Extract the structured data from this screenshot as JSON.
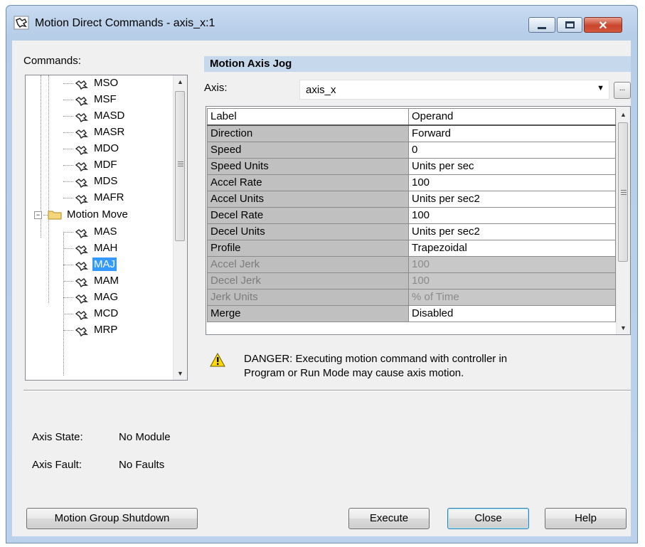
{
  "window": {
    "title": "Motion Direct Commands - axis_x:1"
  },
  "commands": {
    "label": "Commands:",
    "items": [
      {
        "label": "MSO"
      },
      {
        "label": "MSF"
      },
      {
        "label": "MASD"
      },
      {
        "label": "MASR"
      },
      {
        "label": "MDO"
      },
      {
        "label": "MDF"
      },
      {
        "label": "MDS"
      },
      {
        "label": "MAFR"
      }
    ],
    "group": {
      "label": "Motion Move",
      "expander": "−"
    },
    "group_items": [
      {
        "label": "MAS"
      },
      {
        "label": "MAH"
      },
      {
        "label": "MAJ",
        "selected": true
      },
      {
        "label": "MAM"
      },
      {
        "label": "MAG"
      },
      {
        "label": "MCD"
      },
      {
        "label": "MRP"
      }
    ]
  },
  "panel": {
    "title": "Motion Axis Jog",
    "axis_label": "Axis:",
    "axis_value": "axis_x",
    "ellipsis": "...",
    "grid": {
      "headers": [
        "Label",
        "Operand"
      ],
      "rows": [
        {
          "label": "Direction",
          "operand": "Forward",
          "enabled": true
        },
        {
          "label": "Speed",
          "operand": "0",
          "enabled": true
        },
        {
          "label": "Speed Units",
          "operand": "Units per sec",
          "enabled": true
        },
        {
          "label": "Accel Rate",
          "operand": "100",
          "enabled": true
        },
        {
          "label": "Accel Units",
          "operand": "Units per sec2",
          "enabled": true
        },
        {
          "label": "Decel Rate",
          "operand": "100",
          "enabled": true
        },
        {
          "label": "Decel Units",
          "operand": "Units per sec2",
          "enabled": true
        },
        {
          "label": "Profile",
          "operand": "Trapezoidal",
          "enabled": true
        },
        {
          "label": "Accel Jerk",
          "operand": "100",
          "enabled": false
        },
        {
          "label": "Decel Jerk",
          "operand": "100",
          "enabled": false
        },
        {
          "label": "Jerk Units",
          "operand": "% of Time",
          "enabled": false
        },
        {
          "label": "Merge",
          "operand": "Disabled",
          "enabled": true
        }
      ]
    },
    "warning": {
      "line1": "DANGER: Executing motion command with controller in",
      "line2": "Program or Run Mode may cause axis motion."
    }
  },
  "status": {
    "axis_state_label": "Axis State:",
    "axis_state_value": "No Module",
    "axis_fault_label": "Axis Fault:",
    "axis_fault_value": "No Faults"
  },
  "buttons": {
    "shutdown": "Motion Group Shutdown",
    "execute": "Execute",
    "close": "Close",
    "help": "Help"
  },
  "icons": {
    "title": "motion-command-icon",
    "tree_item": "motion-command-icon",
    "folder": "folder-icon",
    "warning": "warning-icon"
  },
  "colors": {
    "selection": "#3399ff",
    "section_header": "#c5d8ec",
    "close_button": "#c9452c"
  }
}
